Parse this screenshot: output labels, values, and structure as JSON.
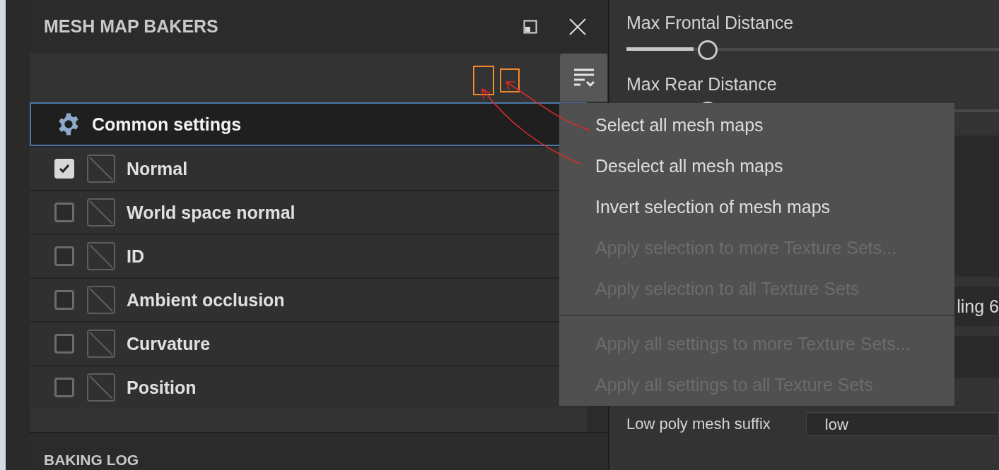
{
  "panel": {
    "title": "MESH MAP BAKERS",
    "common_settings": {
      "label": "Common settings",
      "selected": true
    },
    "maps": [
      {
        "label": "Normal",
        "checked": true
      },
      {
        "label": "World space normal",
        "checked": false
      },
      {
        "label": "ID",
        "checked": false
      },
      {
        "label": "Ambient occlusion",
        "checked": false
      },
      {
        "label": "Curvature",
        "checked": false
      },
      {
        "label": "Position",
        "checked": false
      }
    ]
  },
  "settings": {
    "sliders": [
      {
        "label": "Max Frontal Distance",
        "level": 0.18
      },
      {
        "label": "Max Rear Distance",
        "level": 0.18
      }
    ],
    "partial_value": "ling 6",
    "suffix_field": {
      "label": "Low poly mesh suffix",
      "value": "low"
    }
  },
  "menu": {
    "groups": [
      [
        {
          "label": "Select all mesh maps",
          "disabled": false
        },
        {
          "label": "Deselect all mesh maps",
          "disabled": false
        },
        {
          "label": "Invert selection of mesh maps",
          "disabled": false
        },
        {
          "label": "Apply selection to more Texture Sets...",
          "disabled": true
        },
        {
          "label": "Apply selection to all Texture Sets",
          "disabled": true
        }
      ],
      [
        {
          "label": "Apply all settings to more Texture Sets...",
          "disabled": true
        },
        {
          "label": "Apply all settings to all Texture Sets",
          "disabled": true
        }
      ]
    ]
  },
  "bottom_panel": {
    "title": "BAKING LOG"
  }
}
